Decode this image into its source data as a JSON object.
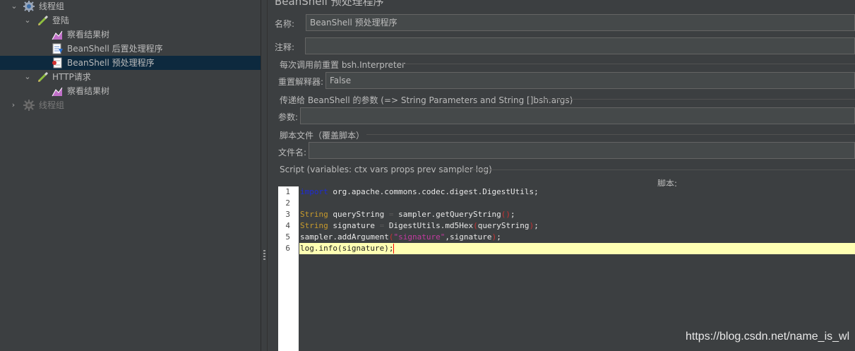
{
  "tree": {
    "items": [
      {
        "label": "线程组",
        "icon": "gear-icon",
        "arrow": "chevron-down-icon",
        "selected": false,
        "dim": false
      },
      {
        "label": "登陆",
        "icon": "sampler-pencil-icon",
        "arrow": "chevron-down-icon",
        "selected": false,
        "dim": false
      },
      {
        "label": "察看结果树",
        "icon": "results-tree-icon",
        "arrow": "",
        "selected": false,
        "dim": false
      },
      {
        "label": "BeanShell 后置处理程序",
        "icon": "post-processor-icon",
        "arrow": "",
        "selected": false,
        "dim": false
      },
      {
        "label": "BeanShell 预处理程序",
        "icon": "pre-processor-icon",
        "arrow": "",
        "selected": true,
        "dim": false
      },
      {
        "label": "HTTP请求",
        "icon": "sampler-pencil-icon",
        "arrow": "chevron-down-icon",
        "selected": false,
        "dim": false
      },
      {
        "label": "察看结果树",
        "icon": "results-tree-icon",
        "arrow": "",
        "selected": false,
        "dim": false
      },
      {
        "label": "线程组",
        "icon": "gear-icon",
        "arrow": "chevron-right-icon",
        "selected": false,
        "dim": true
      }
    ]
  },
  "panel": {
    "title": "BeanShell 预处理程序",
    "name_label": "名称:",
    "name_value": "BeanShell 预处理程序",
    "comment_label": "注释:",
    "comment_value": "",
    "reset_section": "每次调用前重置 bsh.Interpreter",
    "reset_label": "重置解释器:",
    "reset_value": "False",
    "params_section": "传递给 BeanShell 的参数 (=> String Parameters and String []bsh.args)",
    "params_label": "参数:",
    "params_value": "",
    "file_section": "脚本文件（覆盖脚本）",
    "file_label": "文件名:",
    "file_value": "",
    "script_section": "Script (variables: ctx vars props prev sampler log)",
    "script_label": "脚本:"
  },
  "editor": {
    "line_numbers": [
      "1",
      "2",
      "3",
      "4",
      "5",
      "6"
    ],
    "lines": [
      "import org.apache.commons.codec.digest.DigestUtils;",
      "",
      "String queryString = sampler.getQueryString();",
      "String signature = DigestUtils.md5Hex(queryString);",
      "sampler.addArgument(\"signature\",signature);",
      "log.info(signature);"
    ],
    "current_line": 6
  },
  "watermark": "https://blog.csdn.net/name_is_wl",
  "colors": {
    "background": "#3c3f41",
    "selection": "#0d293e",
    "current_line": "#ffffb3",
    "keyword": "#1d2bd6",
    "type": "#c89b2c",
    "string": "#c33aa0"
  }
}
